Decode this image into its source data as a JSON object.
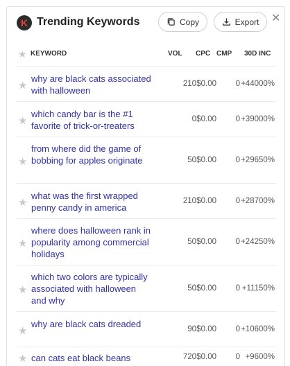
{
  "header": {
    "logo_letter": "K",
    "title": "Trending Keywords",
    "copy_label": "Copy",
    "export_label": "Export",
    "close_symbol": "✕"
  },
  "columns": {
    "keyword": "KEYWORD",
    "vol": "VOL",
    "cpc": "CPC",
    "cmp": "CMP",
    "inc": "30D INC"
  },
  "rows": [
    {
      "keyword": "why are black cats associated with halloween",
      "vol": "210",
      "cpc": "$0.00",
      "cmp": "0",
      "inc": "+44000%"
    },
    {
      "keyword": "which candy bar is the #1 favorite of trick-or-treaters",
      "vol": "0",
      "cpc": "$0.00",
      "cmp": "0",
      "inc": "+39000%"
    },
    {
      "keyword": "from where did the game of bobbing for apples originate",
      "vol": "50",
      "cpc": "$0.00",
      "cmp": "0",
      "inc": "+29650%"
    },
    {
      "keyword": "what was the first wrapped penny candy in america",
      "vol": "210",
      "cpc": "$0.00",
      "cmp": "0",
      "inc": "+28700%"
    },
    {
      "keyword": "where does halloween rank in popularity among commercial holidays",
      "vol": "50",
      "cpc": "$0.00",
      "cmp": "0",
      "inc": "+24250%"
    },
    {
      "keyword": "which two colors are typically associated with halloween and why",
      "vol": "50",
      "cpc": "$0.00",
      "cmp": "0",
      "inc": "+11150%"
    },
    {
      "keyword": "why are black cats dreaded",
      "vol": "90",
      "cpc": "$0.00",
      "cmp": "0",
      "inc": "+10600%"
    },
    {
      "keyword": "can cats eat black beans",
      "vol": "720",
      "cpc": "$0.00",
      "cmp": "0",
      "inc": "+9600%"
    }
  ]
}
